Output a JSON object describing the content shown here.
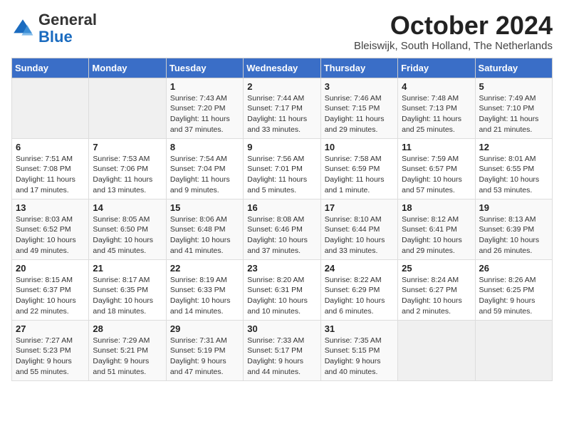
{
  "logo": {
    "general": "General",
    "blue": "Blue"
  },
  "title": "October 2024",
  "location": "Bleiswijk, South Holland, The Netherlands",
  "weekdays": [
    "Sunday",
    "Monday",
    "Tuesday",
    "Wednesday",
    "Thursday",
    "Friday",
    "Saturday"
  ],
  "weeks": [
    [
      {
        "day": "",
        "sunrise": "",
        "sunset": "",
        "daylight": ""
      },
      {
        "day": "",
        "sunrise": "",
        "sunset": "",
        "daylight": ""
      },
      {
        "day": "1",
        "sunrise": "Sunrise: 7:43 AM",
        "sunset": "Sunset: 7:20 PM",
        "daylight": "Daylight: 11 hours and 37 minutes."
      },
      {
        "day": "2",
        "sunrise": "Sunrise: 7:44 AM",
        "sunset": "Sunset: 7:17 PM",
        "daylight": "Daylight: 11 hours and 33 minutes."
      },
      {
        "day": "3",
        "sunrise": "Sunrise: 7:46 AM",
        "sunset": "Sunset: 7:15 PM",
        "daylight": "Daylight: 11 hours and 29 minutes."
      },
      {
        "day": "4",
        "sunrise": "Sunrise: 7:48 AM",
        "sunset": "Sunset: 7:13 PM",
        "daylight": "Daylight: 11 hours and 25 minutes."
      },
      {
        "day": "5",
        "sunrise": "Sunrise: 7:49 AM",
        "sunset": "Sunset: 7:10 PM",
        "daylight": "Daylight: 11 hours and 21 minutes."
      }
    ],
    [
      {
        "day": "6",
        "sunrise": "Sunrise: 7:51 AM",
        "sunset": "Sunset: 7:08 PM",
        "daylight": "Daylight: 11 hours and 17 minutes."
      },
      {
        "day": "7",
        "sunrise": "Sunrise: 7:53 AM",
        "sunset": "Sunset: 7:06 PM",
        "daylight": "Daylight: 11 hours and 13 minutes."
      },
      {
        "day": "8",
        "sunrise": "Sunrise: 7:54 AM",
        "sunset": "Sunset: 7:04 PM",
        "daylight": "Daylight: 11 hours and 9 minutes."
      },
      {
        "day": "9",
        "sunrise": "Sunrise: 7:56 AM",
        "sunset": "Sunset: 7:01 PM",
        "daylight": "Daylight: 11 hours and 5 minutes."
      },
      {
        "day": "10",
        "sunrise": "Sunrise: 7:58 AM",
        "sunset": "Sunset: 6:59 PM",
        "daylight": "Daylight: 11 hours and 1 minute."
      },
      {
        "day": "11",
        "sunrise": "Sunrise: 7:59 AM",
        "sunset": "Sunset: 6:57 PM",
        "daylight": "Daylight: 10 hours and 57 minutes."
      },
      {
        "day": "12",
        "sunrise": "Sunrise: 8:01 AM",
        "sunset": "Sunset: 6:55 PM",
        "daylight": "Daylight: 10 hours and 53 minutes."
      }
    ],
    [
      {
        "day": "13",
        "sunrise": "Sunrise: 8:03 AM",
        "sunset": "Sunset: 6:52 PM",
        "daylight": "Daylight: 10 hours and 49 minutes."
      },
      {
        "day": "14",
        "sunrise": "Sunrise: 8:05 AM",
        "sunset": "Sunset: 6:50 PM",
        "daylight": "Daylight: 10 hours and 45 minutes."
      },
      {
        "day": "15",
        "sunrise": "Sunrise: 8:06 AM",
        "sunset": "Sunset: 6:48 PM",
        "daylight": "Daylight: 10 hours and 41 minutes."
      },
      {
        "day": "16",
        "sunrise": "Sunrise: 8:08 AM",
        "sunset": "Sunset: 6:46 PM",
        "daylight": "Daylight: 10 hours and 37 minutes."
      },
      {
        "day": "17",
        "sunrise": "Sunrise: 8:10 AM",
        "sunset": "Sunset: 6:44 PM",
        "daylight": "Daylight: 10 hours and 33 minutes."
      },
      {
        "day": "18",
        "sunrise": "Sunrise: 8:12 AM",
        "sunset": "Sunset: 6:41 PM",
        "daylight": "Daylight: 10 hours and 29 minutes."
      },
      {
        "day": "19",
        "sunrise": "Sunrise: 8:13 AM",
        "sunset": "Sunset: 6:39 PM",
        "daylight": "Daylight: 10 hours and 26 minutes."
      }
    ],
    [
      {
        "day": "20",
        "sunrise": "Sunrise: 8:15 AM",
        "sunset": "Sunset: 6:37 PM",
        "daylight": "Daylight: 10 hours and 22 minutes."
      },
      {
        "day": "21",
        "sunrise": "Sunrise: 8:17 AM",
        "sunset": "Sunset: 6:35 PM",
        "daylight": "Daylight: 10 hours and 18 minutes."
      },
      {
        "day": "22",
        "sunrise": "Sunrise: 8:19 AM",
        "sunset": "Sunset: 6:33 PM",
        "daylight": "Daylight: 10 hours and 14 minutes."
      },
      {
        "day": "23",
        "sunrise": "Sunrise: 8:20 AM",
        "sunset": "Sunset: 6:31 PM",
        "daylight": "Daylight: 10 hours and 10 minutes."
      },
      {
        "day": "24",
        "sunrise": "Sunrise: 8:22 AM",
        "sunset": "Sunset: 6:29 PM",
        "daylight": "Daylight: 10 hours and 6 minutes."
      },
      {
        "day": "25",
        "sunrise": "Sunrise: 8:24 AM",
        "sunset": "Sunset: 6:27 PM",
        "daylight": "Daylight: 10 hours and 2 minutes."
      },
      {
        "day": "26",
        "sunrise": "Sunrise: 8:26 AM",
        "sunset": "Sunset: 6:25 PM",
        "daylight": "Daylight: 9 hours and 59 minutes."
      }
    ],
    [
      {
        "day": "27",
        "sunrise": "Sunrise: 7:27 AM",
        "sunset": "Sunset: 5:23 PM",
        "daylight": "Daylight: 9 hours and 55 minutes."
      },
      {
        "day": "28",
        "sunrise": "Sunrise: 7:29 AM",
        "sunset": "Sunset: 5:21 PM",
        "daylight": "Daylight: 9 hours and 51 minutes."
      },
      {
        "day": "29",
        "sunrise": "Sunrise: 7:31 AM",
        "sunset": "Sunset: 5:19 PM",
        "daylight": "Daylight: 9 hours and 47 minutes."
      },
      {
        "day": "30",
        "sunrise": "Sunrise: 7:33 AM",
        "sunset": "Sunset: 5:17 PM",
        "daylight": "Daylight: 9 hours and 44 minutes."
      },
      {
        "day": "31",
        "sunrise": "Sunrise: 7:35 AM",
        "sunset": "Sunset: 5:15 PM",
        "daylight": "Daylight: 9 hours and 40 minutes."
      },
      {
        "day": "",
        "sunrise": "",
        "sunset": "",
        "daylight": ""
      },
      {
        "day": "",
        "sunrise": "",
        "sunset": "",
        "daylight": ""
      }
    ]
  ]
}
